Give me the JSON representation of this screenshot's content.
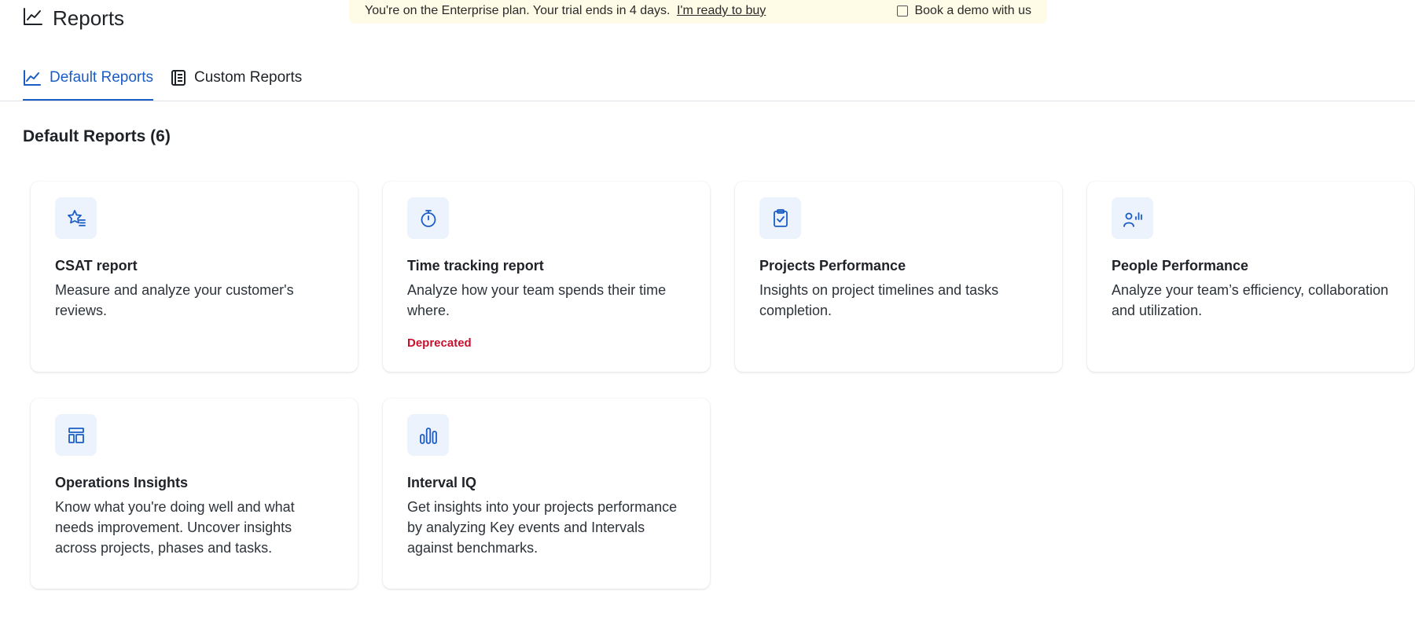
{
  "banner": {
    "text": "You're on the Enterprise plan. Your trial ends in 4 days.",
    "link": "I'm ready to buy",
    "demo_label": "Book a demo with us"
  },
  "header": {
    "title": "Reports",
    "icon": "chart-line-icon"
  },
  "tabs": [
    {
      "label": "Default Reports",
      "icon": "chart-line-icon",
      "active": true
    },
    {
      "label": "Custom Reports",
      "icon": "document-list-icon",
      "active": false
    }
  ],
  "section": {
    "title": "Default Reports (6)"
  },
  "cards": [
    {
      "title": "CSAT report",
      "description": "Measure and analyze your customer's reviews.",
      "icon": "star-list-icon",
      "badge": ""
    },
    {
      "title": "Time tracking report",
      "description": "Analyze how your team spends their time where.",
      "icon": "stopwatch-icon",
      "badge": "Deprecated"
    },
    {
      "title": "Projects Performance",
      "description": "Insights on project timelines and tasks completion.",
      "icon": "clipboard-check-icon",
      "badge": ""
    },
    {
      "title": "People Performance",
      "description": "Analyze your team’s efficiency, collaboration and utilization.",
      "icon": "person-chart-icon",
      "badge": ""
    },
    {
      "title": "Operations Insights",
      "description": "Know what you're doing well and what needs improvement. Uncover insights across projects, phases and tasks.",
      "icon": "layout-icon",
      "badge": ""
    },
    {
      "title": "Interval IQ",
      "description": "Get insights into your projects performance by analyzing Key events and Intervals against benchmarks.",
      "icon": "bar-chart-icon",
      "badge": ""
    }
  ],
  "colors": {
    "accent": "#1b5dc4",
    "icon_bg": "#ecf3fd",
    "deprecated": "#c8102e",
    "banner_bg": "#fefbe6"
  }
}
